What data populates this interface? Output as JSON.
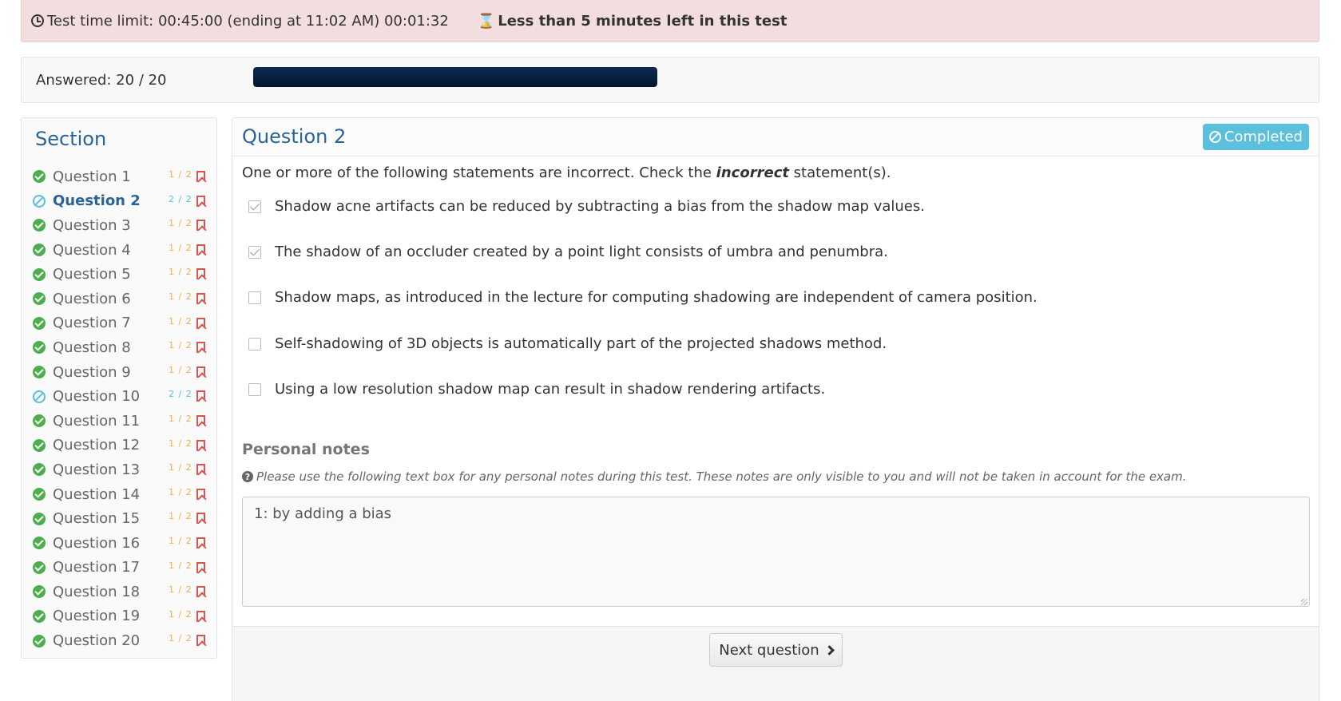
{
  "timer": {
    "limit_text": "Test time limit: 00:45:00 (ending at 11:02 AM) 00:01:32",
    "warning_text": "Less than 5 minutes left in this test"
  },
  "progress": {
    "label": "Answered: 20 / 20",
    "fraction": 1.0
  },
  "sidebar": {
    "title": "Section",
    "items": [
      {
        "label": "Question 1",
        "score": "1 / 2",
        "status": "ok"
      },
      {
        "label": "Question 2",
        "score": "2 / 2",
        "status": "skip",
        "active": true
      },
      {
        "label": "Question 3",
        "score": "1 / 2",
        "status": "ok"
      },
      {
        "label": "Question 4",
        "score": "1 / 2",
        "status": "ok"
      },
      {
        "label": "Question 5",
        "score": "1 / 2",
        "status": "ok"
      },
      {
        "label": "Question 6",
        "score": "1 / 2",
        "status": "ok"
      },
      {
        "label": "Question 7",
        "score": "1 / 2",
        "status": "ok"
      },
      {
        "label": "Question 8",
        "score": "1 / 2",
        "status": "ok"
      },
      {
        "label": "Question 9",
        "score": "1 / 2",
        "status": "ok"
      },
      {
        "label": "Question 10",
        "score": "2 / 2",
        "status": "skip"
      },
      {
        "label": "Question 11",
        "score": "1 / 2",
        "status": "ok"
      },
      {
        "label": "Question 12",
        "score": "1 / 2",
        "status": "ok"
      },
      {
        "label": "Question 13",
        "score": "1 / 2",
        "status": "ok"
      },
      {
        "label": "Question 14",
        "score": "1 / 2",
        "status": "ok"
      },
      {
        "label": "Question 15",
        "score": "1 / 2",
        "status": "ok"
      },
      {
        "label": "Question 16",
        "score": "1 / 2",
        "status": "ok"
      },
      {
        "label": "Question 17",
        "score": "1 / 2",
        "status": "ok"
      },
      {
        "label": "Question 18",
        "score": "1 / 2",
        "status": "ok"
      },
      {
        "label": "Question 19",
        "score": "1 / 2",
        "status": "ok"
      },
      {
        "label": "Question 20",
        "score": "1 / 2",
        "status": "ok"
      }
    ]
  },
  "question": {
    "title": "Question 2",
    "badge": "Completed",
    "prompt_before": "One or more of the following statements are incorrect. Check the ",
    "prompt_emphasis": "incorrect",
    "prompt_after": " statement(s).",
    "options": [
      {
        "text": "Shadow acne artifacts can be reduced by subtracting a bias from the shadow map values.",
        "checked": true
      },
      {
        "text": "The shadow of an occluder created by a point light consists of umbra and penumbra.",
        "checked": true
      },
      {
        "text": "Shadow maps, as introduced in the lecture for computing shadowing are independent of camera position.",
        "checked": false
      },
      {
        "text": "Self-shadowing of 3D objects is automatically part of the projected shadows method.",
        "checked": false
      },
      {
        "text": "Using a low resolution shadow map can result in shadow rendering artifacts.",
        "checked": false
      }
    ]
  },
  "notes": {
    "title": "Personal notes",
    "help": "Please use the following text box for any personal notes during this test. These notes are only visible to you and will not be taken in account for the exam.",
    "value": "1: by adding a bias"
  },
  "footer": {
    "next_label": "Next question"
  }
}
